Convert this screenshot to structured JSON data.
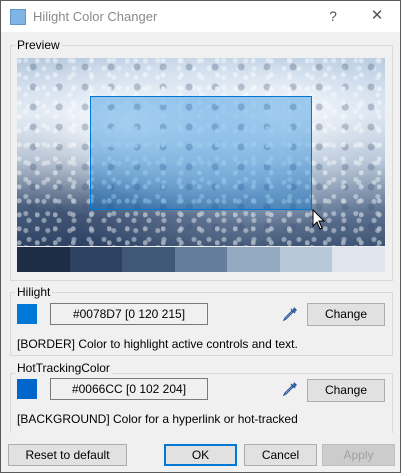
{
  "window": {
    "title": "Hilight Color Changer",
    "help_glyph": "?",
    "close_glyph": "✕"
  },
  "preview": {
    "label": "Preview",
    "swatches": [
      "#1e2c45",
      "#2d4163",
      "#3f5878",
      "#637d9a",
      "#93a9c2",
      "#b9c8d9",
      "#dfe5ec"
    ]
  },
  "hilight": {
    "label": "Hilight",
    "color": "#0078d7",
    "value": "#0078D7 [0 120 215]",
    "change_label": "Change",
    "description": "[BORDER] Color to highlight active controls and text."
  },
  "hot_tracking": {
    "label": "HotTrackingColor",
    "color": "#0066cc",
    "value": "#0066CC [0 102 204]",
    "change_label": "Change",
    "description": "[BACKGROUND] Color for a hyperlink or hot-tracked"
  },
  "footer": {
    "reset_label": "Reset to default",
    "ok_label": "OK",
    "cancel_label": "Cancel",
    "apply_label": "Apply"
  }
}
